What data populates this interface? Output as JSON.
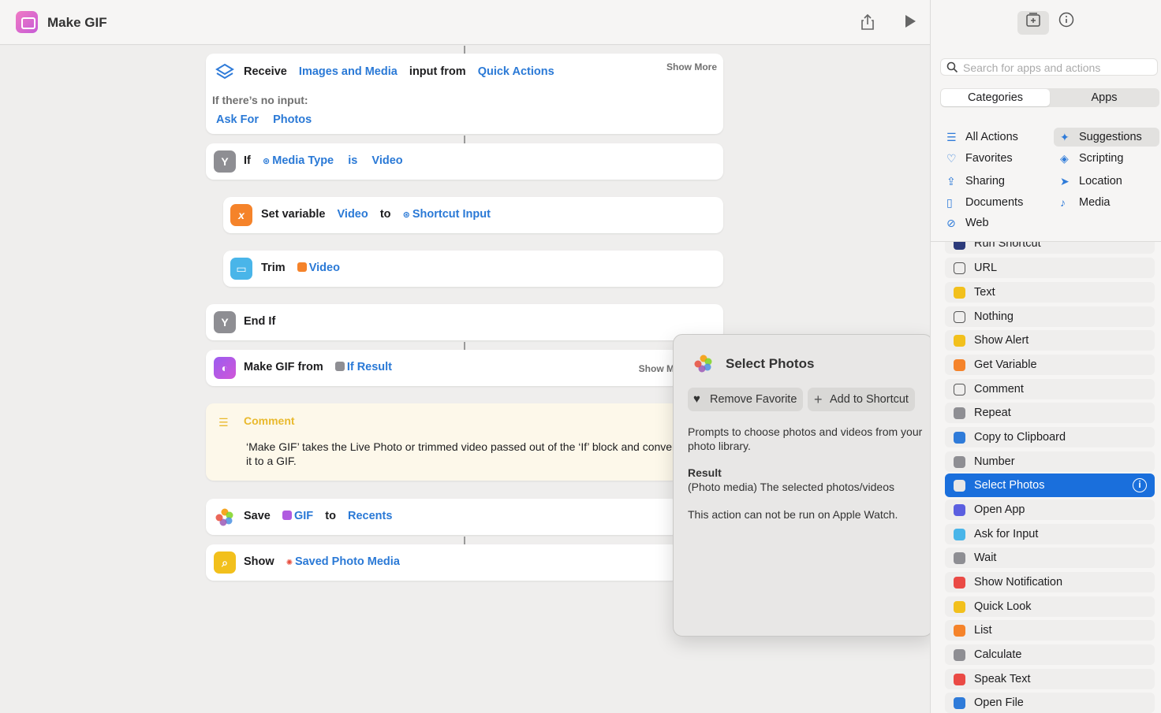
{
  "app": {
    "title": "Make GIF"
  },
  "actions": {
    "receive": {
      "kw1": "Receive",
      "tok1": "Images and Media",
      "kw2": "input from",
      "tok2": "Quick Actions",
      "show_more": "Show More",
      "no_input": "If there’s no input:",
      "tok3": "Ask For",
      "tok4": "Photos"
    },
    "if": {
      "kw1": "If",
      "tok1": "Media Type",
      "tok2": "is",
      "tok3": "Video"
    },
    "setvar": {
      "kw1": "Set variable",
      "tok1": "Video",
      "kw2": "to",
      "tok2": "Shortcut Input"
    },
    "trim": {
      "kw1": "Trim",
      "tok1": "Video"
    },
    "endif": {
      "kw1": "End If"
    },
    "makegif": {
      "kw1": "Make GIF from",
      "tok1": "If Result",
      "show_more": "Show M"
    },
    "comment": {
      "title": "Comment",
      "body": "‘Make GIF’ takes the Live Photo or trimmed video passed out of the ‘If’ block and converts it to a GIF."
    },
    "save": {
      "kw1": "Save",
      "tok1": "GIF",
      "kw2": "to",
      "tok2": "Recents"
    },
    "show": {
      "kw1": "Show",
      "tok1": "Saved Photo Media"
    }
  },
  "popover": {
    "title": "Select Photos",
    "remove_favorite": "Remove Favorite",
    "add_to_shortcut": "Add to Shortcut",
    "description": "Prompts to choose photos and videos from your photo library.",
    "result_label": "Result",
    "result_text": "(Photo media) The selected photos/videos",
    "note": "This action can not be run on Apple Watch."
  },
  "sidebar": {
    "search_placeholder": "Search for apps and actions",
    "tabs": [
      "Categories",
      "Apps"
    ],
    "categories_left": [
      "All Actions",
      "Favorites",
      "Sharing",
      "Documents",
      "Web"
    ],
    "categories_right": [
      "Suggestions",
      "Scripting",
      "Location",
      "Media"
    ],
    "list": [
      "Run Shortcut",
      "URL",
      "Text",
      "Nothing",
      "Show Alert",
      "Get Variable",
      "Comment",
      "Repeat",
      "Copy to Clipboard",
      "Number",
      "Select Photos",
      "Open App",
      "Ask for Input",
      "Wait",
      "Show Notification",
      "Quick Look",
      "List",
      "Calculate",
      "Speak Text",
      "Open File"
    ],
    "list_colors": [
      "#2b3a7a",
      "#ffffff",
      "#f2c01c",
      "#ffffff",
      "#f2c01c",
      "#f5832a",
      "#ffffff",
      "#8e8e93",
      "#2f7bd9",
      "#8e8e93",
      "#e8e7e6",
      "#5b5fe0",
      "#49b5e9",
      "#8e8e93",
      "#ea4a45",
      "#f2c01c",
      "#f5832a",
      "#8e8e93",
      "#ea4a45",
      "#2f7bd9"
    ]
  }
}
